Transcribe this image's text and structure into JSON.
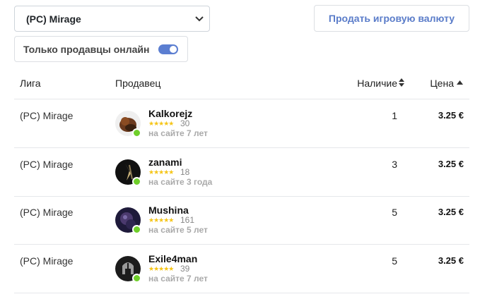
{
  "filters": {
    "league_select": {
      "selected": "(PC) Mirage"
    },
    "sell_button_label": "Продать игровую валюту",
    "online_only": {
      "label": "Только продавцы онлайн",
      "enabled": true
    }
  },
  "table": {
    "headers": {
      "league": "Лига",
      "seller": "Продавец",
      "stock": "Наличие",
      "price": "Цена"
    },
    "rows": [
      {
        "league": "(PC) Mirage",
        "seller": "Kalkorejz",
        "stars": "★★★★★",
        "rating": "30",
        "since": "на сайте 7 лет",
        "stock": "1",
        "price": "3.25 €"
      },
      {
        "league": "(PC) Mirage",
        "seller": "zanami",
        "stars": "★★★★★",
        "rating": "18",
        "since": "на сайте 3 года",
        "stock": "3",
        "price": "3.25 €"
      },
      {
        "league": "(PC) Mirage",
        "seller": "Mushina",
        "stars": "★★★★★",
        "rating": "161",
        "since": "на сайте 5 лет",
        "stock": "5",
        "price": "3.25 €"
      },
      {
        "league": "(PC) Mirage",
        "seller": "Exile4man",
        "stars": "★★★★★",
        "rating": "39",
        "since": "на сайте 7 лет",
        "stock": "5",
        "price": "3.25 €"
      }
    ]
  },
  "colors": {
    "accent": "#5b7ed1",
    "online": "#6fcf2a",
    "star": "#f5c518"
  },
  "icons": {
    "select_chevron": "chevron-down-icon",
    "stock_sort": "sort-both-icon",
    "price_sort": "sort-up-icon",
    "online_status": "online-dot-icon"
  }
}
